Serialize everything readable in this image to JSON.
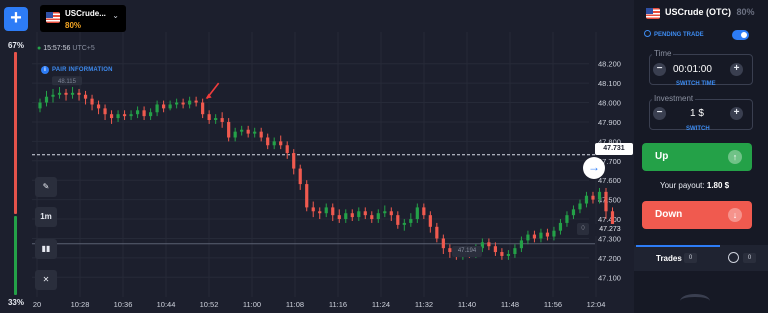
{
  "toolbar": {
    "add_label": "+"
  },
  "sentiment": {
    "up_pct": "67%",
    "down_pct": "33%",
    "up_ratio": 0.67
  },
  "asset": {
    "name": "USCrude...",
    "payout": "80%"
  },
  "chart_header": {
    "time": "15:57:56",
    "timezone": "UTC+5",
    "info_label": "PAIR INFORMATION"
  },
  "tools": {
    "timeframe": "1m"
  },
  "chart_data": {
    "type": "candlestick",
    "x_ticks": [
      "20",
      "10:28",
      "10:36",
      "10:44",
      "10:52",
      "11:00",
      "11:08",
      "11:16",
      "11:24",
      "11:32",
      "11:40",
      "11:48",
      "11:56",
      "12:04"
    ],
    "y_ticks": [
      "48.200",
      "48.100",
      "48.000",
      "47.900",
      "47.800",
      "47.700",
      "47.600",
      "47.500",
      "47.400",
      "47.300",
      "47.200",
      "47.100"
    ],
    "ylim": [
      47.05,
      48.25
    ],
    "current_price": "47.731",
    "alert_price": "47.273",
    "low_label": "47.194",
    "old_label": "48.115",
    "candles": [
      [
        47.97,
        48.0,
        48.02,
        47.95
      ],
      [
        48.0,
        48.03,
        48.06,
        47.98
      ],
      [
        48.03,
        48.04,
        48.07,
        48.0
      ],
      [
        48.04,
        48.05,
        48.08,
        48.02
      ],
      [
        48.05,
        48.04,
        48.07,
        48.01
      ],
      [
        48.04,
        48.05,
        48.08,
        48.02
      ],
      [
        48.05,
        48.04,
        48.07,
        48.01
      ],
      [
        48.04,
        48.02,
        48.06,
        47.99
      ],
      [
        48.02,
        47.99,
        48.04,
        47.96
      ],
      [
        47.99,
        47.97,
        48.01,
        47.94
      ],
      [
        47.97,
        47.94,
        47.99,
        47.91
      ],
      [
        47.94,
        47.92,
        47.96,
        47.89
      ],
      [
        47.92,
        47.94,
        47.96,
        47.9
      ],
      [
        47.94,
        47.93,
        47.96,
        47.91
      ],
      [
        47.93,
        47.94,
        47.96,
        47.91
      ],
      [
        47.94,
        47.96,
        47.98,
        47.92
      ],
      [
        47.96,
        47.93,
        47.98,
        47.91
      ],
      [
        47.93,
        47.95,
        47.97,
        47.91
      ],
      [
        47.95,
        47.99,
        48.01,
        47.93
      ],
      [
        47.99,
        47.97,
        48.01,
        47.95
      ],
      [
        47.97,
        47.99,
        48.01,
        47.96
      ],
      [
        47.99,
        48.0,
        48.02,
        47.97
      ],
      [
        48.0,
        47.99,
        48.02,
        47.97
      ],
      [
        47.99,
        48.01,
        48.03,
        47.97
      ],
      [
        48.01,
        48.0,
        48.03,
        47.98
      ],
      [
        48.0,
        47.94,
        48.02,
        47.92
      ],
      [
        47.94,
        47.91,
        47.96,
        47.89
      ],
      [
        47.91,
        47.92,
        47.94,
        47.89
      ],
      [
        47.92,
        47.9,
        47.95,
        47.87
      ],
      [
        47.9,
        47.82,
        47.92,
        47.8
      ],
      [
        47.82,
        47.85,
        47.87,
        47.8
      ],
      [
        47.85,
        47.86,
        47.88,
        47.83
      ],
      [
        47.86,
        47.84,
        47.88,
        47.82
      ],
      [
        47.84,
        47.85,
        47.87,
        47.82
      ],
      [
        47.85,
        47.82,
        47.87,
        47.8
      ],
      [
        47.82,
        47.78,
        47.84,
        47.76
      ],
      [
        47.78,
        47.8,
        47.82,
        47.76
      ],
      [
        47.8,
        47.78,
        47.83,
        47.76
      ],
      [
        47.78,
        47.74,
        47.8,
        47.71
      ],
      [
        47.74,
        47.66,
        47.76,
        47.63
      ],
      [
        47.66,
        47.58,
        47.68,
        47.55
      ],
      [
        47.58,
        47.46,
        47.6,
        47.44
      ],
      [
        47.46,
        47.44,
        47.49,
        47.41
      ],
      [
        47.44,
        47.43,
        47.46,
        47.4
      ],
      [
        47.43,
        47.46,
        47.48,
        47.41
      ],
      [
        47.46,
        47.42,
        47.48,
        47.39
      ],
      [
        47.42,
        47.4,
        47.45,
        47.38
      ],
      [
        47.4,
        47.43,
        47.45,
        47.38
      ],
      [
        47.43,
        47.41,
        47.45,
        47.39
      ],
      [
        47.41,
        47.44,
        47.46,
        47.39
      ],
      [
        47.44,
        47.42,
        47.46,
        47.4
      ],
      [
        47.42,
        47.4,
        47.44,
        47.38
      ],
      [
        47.4,
        47.43,
        47.45,
        47.38
      ],
      [
        47.43,
        47.44,
        47.47,
        47.41
      ],
      [
        47.44,
        47.42,
        47.46,
        47.39
      ],
      [
        47.42,
        47.37,
        47.44,
        47.35
      ],
      [
        47.37,
        47.38,
        47.4,
        47.34
      ],
      [
        47.38,
        47.4,
        47.43,
        47.36
      ],
      [
        47.4,
        47.46,
        47.48,
        47.38
      ],
      [
        47.46,
        47.42,
        47.48,
        47.4
      ],
      [
        47.42,
        47.36,
        47.44,
        47.33
      ],
      [
        47.36,
        47.3,
        47.38,
        47.28
      ],
      [
        47.3,
        47.25,
        47.32,
        47.22
      ],
      [
        47.25,
        47.23,
        47.27,
        47.2
      ],
      [
        47.23,
        47.21,
        47.25,
        47.19
      ],
      [
        47.21,
        47.23,
        47.25,
        47.19
      ],
      [
        47.23,
        47.22,
        47.25,
        47.2
      ],
      [
        47.22,
        47.25,
        47.27,
        47.2
      ],
      [
        47.25,
        47.28,
        47.3,
        47.23
      ],
      [
        47.28,
        47.26,
        47.3,
        47.24
      ],
      [
        47.26,
        47.23,
        47.28,
        47.21
      ],
      [
        47.23,
        47.21,
        47.25,
        47.19
      ],
      [
        47.21,
        47.22,
        47.24,
        47.19
      ],
      [
        47.22,
        47.25,
        47.27,
        47.2
      ],
      [
        47.25,
        47.29,
        47.31,
        47.23
      ],
      [
        47.29,
        47.32,
        47.34,
        47.27
      ],
      [
        47.32,
        47.3,
        47.34,
        47.28
      ],
      [
        47.3,
        47.33,
        47.35,
        47.28
      ],
      [
        47.33,
        47.31,
        47.35,
        47.29
      ],
      [
        47.31,
        47.34,
        47.36,
        47.29
      ],
      [
        47.34,
        47.38,
        47.4,
        47.32
      ],
      [
        47.38,
        47.42,
        47.44,
        47.36
      ],
      [
        47.42,
        47.45,
        47.47,
        47.4
      ],
      [
        47.45,
        47.48,
        47.5,
        47.43
      ],
      [
        47.48,
        47.52,
        47.54,
        47.46
      ],
      [
        47.52,
        47.5,
        47.54,
        47.48
      ],
      [
        47.5,
        47.54,
        47.56,
        47.48
      ],
      [
        47.54,
        47.44,
        47.56,
        47.4
      ],
      [
        47.44,
        47.36,
        47.46,
        47.33
      ]
    ],
    "colors": {
      "up": "#24a148",
      "down": "#f05a4f"
    }
  },
  "panel": {
    "asset_title": "USCrude (OTC)",
    "asset_payout": "80%",
    "pending_label": "PENDING TRADE",
    "time_label": "Time",
    "time_value": "00:01:00",
    "switch_time": "SWITCH TIME",
    "investment_label": "Investment",
    "investment_value": "1 $",
    "switch": "SWITCH",
    "up_label": "Up",
    "down_label": "Down",
    "payout_label": "Your payout:",
    "payout_value": "1.80 $",
    "trades_label": "Trades",
    "trades_count": "0",
    "history_count": "0"
  }
}
